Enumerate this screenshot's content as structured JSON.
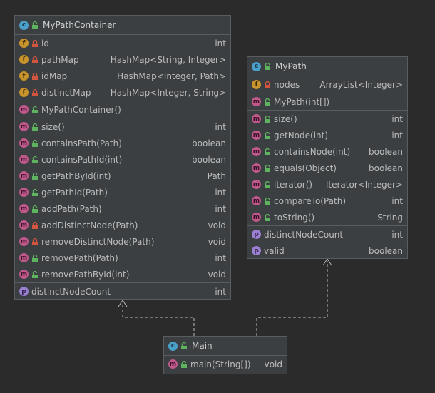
{
  "container": {
    "name": "MyPathContainer",
    "fields": [
      {
        "name": "id",
        "type": "int",
        "vis": "private"
      },
      {
        "name": "pathMap",
        "type": "HashMap<String, Integer>",
        "vis": "private"
      },
      {
        "name": "idMap",
        "type": "HashMap<Integer, Path>",
        "vis": "private"
      },
      {
        "name": "distinctMap",
        "type": "HashMap<Integer, String>",
        "vis": "private"
      }
    ],
    "constructors": [
      {
        "name": "MyPathContainer()",
        "type": "",
        "vis": "public"
      }
    ],
    "methods": [
      {
        "name": "size()",
        "type": "int",
        "vis": "public"
      },
      {
        "name": "containsPath(Path)",
        "type": "boolean",
        "vis": "public"
      },
      {
        "name": "containsPathId(int)",
        "type": "boolean",
        "vis": "public"
      },
      {
        "name": "getPathById(int)",
        "type": "Path",
        "vis": "public"
      },
      {
        "name": "getPathId(Path)",
        "type": "int",
        "vis": "public"
      },
      {
        "name": "addPath(Path)",
        "type": "int",
        "vis": "public"
      },
      {
        "name": "addDistinctNode(Path)",
        "type": "void",
        "vis": "private"
      },
      {
        "name": "removeDistinctNode(Path)",
        "type": "void",
        "vis": "private"
      },
      {
        "name": "removePath(Path)",
        "type": "int",
        "vis": "public"
      },
      {
        "name": "removePathById(int)",
        "type": "void",
        "vis": "public"
      }
    ],
    "properties": [
      {
        "name": "distinctNodeCount",
        "type": "int"
      }
    ]
  },
  "mypath": {
    "name": "MyPath",
    "fields": [
      {
        "name": "nodes",
        "type": "ArrayList<Integer>",
        "vis": "private"
      }
    ],
    "constructors": [
      {
        "name": "MyPath(int[])",
        "type": "",
        "vis": "public"
      }
    ],
    "methods": [
      {
        "name": "size()",
        "type": "int",
        "vis": "public"
      },
      {
        "name": "getNode(int)",
        "type": "int",
        "vis": "public"
      },
      {
        "name": "containsNode(int)",
        "type": "boolean",
        "vis": "public"
      },
      {
        "name": "equals(Object)",
        "type": "boolean",
        "vis": "public"
      },
      {
        "name": "iterator()",
        "type": "Iterator<Integer>",
        "vis": "public"
      },
      {
        "name": "compareTo(Path)",
        "type": "int",
        "vis": "public"
      },
      {
        "name": "toString()",
        "type": "String",
        "vis": "public"
      }
    ],
    "properties": [
      {
        "name": "distinctNodeCount",
        "type": "int"
      },
      {
        "name": "valid",
        "type": "boolean"
      }
    ]
  },
  "main": {
    "name": "Main",
    "methods": [
      {
        "name": "main(String[])",
        "type": "void",
        "vis": "public"
      }
    ]
  },
  "colors": {
    "class_icon": "#4aa0c8",
    "field_icon": "#c9942b",
    "method_icon": "#c0598b",
    "property_icon": "#9b7fd0",
    "public_vis": "#5eb35e",
    "private_vis": "#d2553f",
    "dependency_line": "#bbbbbb"
  }
}
